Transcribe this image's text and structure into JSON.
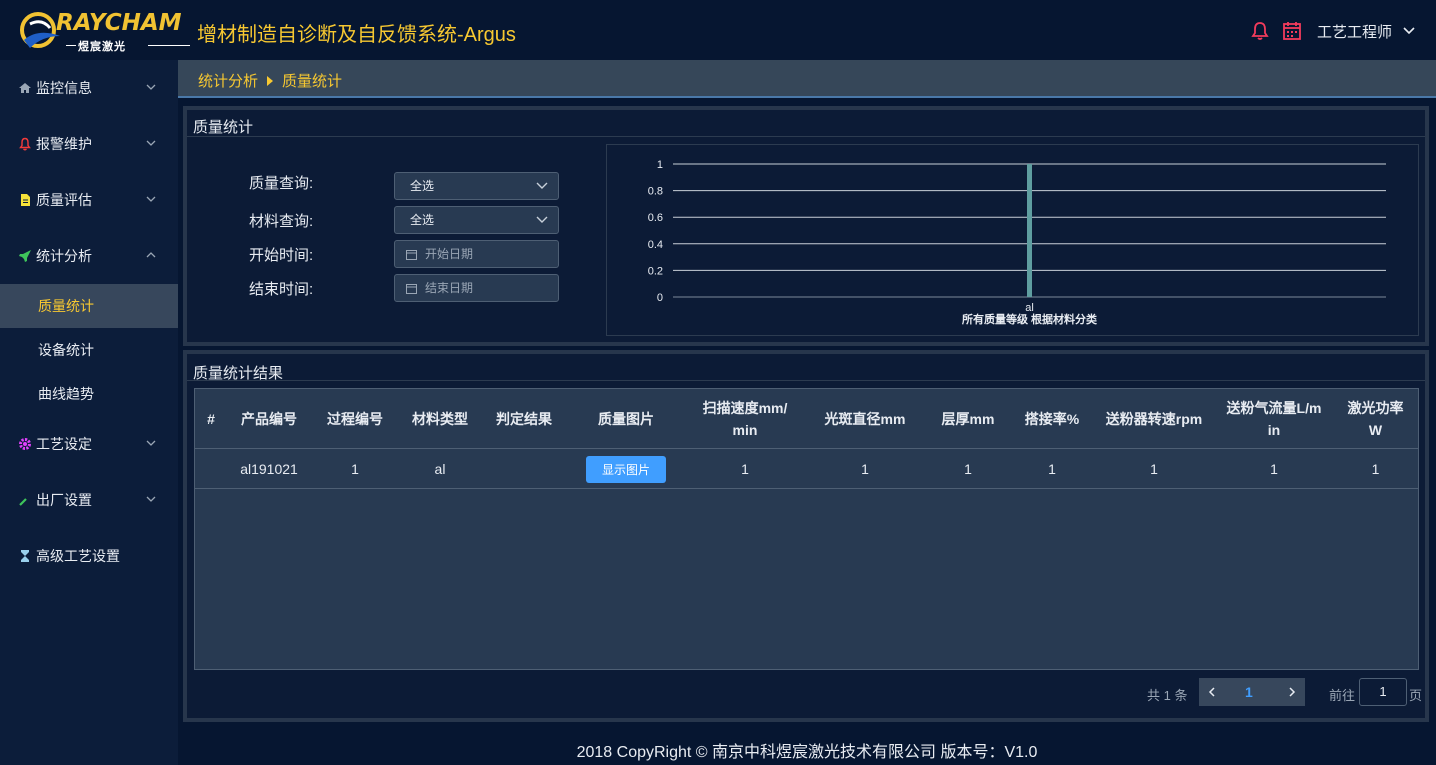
{
  "header": {
    "logo_text": "RAYCHAM",
    "logo_sub": "煜宸激光",
    "app_title": "增材制造自诊断及自反馈系统-Argus",
    "user_name": "工艺工程师"
  },
  "sidebar": {
    "items": [
      {
        "label": "监控信息",
        "icon": "home-icon",
        "expanded": false
      },
      {
        "label": "报警维护",
        "icon": "bell-icon",
        "expanded": false
      },
      {
        "label": "质量评估",
        "icon": "document-icon",
        "expanded": false
      },
      {
        "label": "统计分析",
        "icon": "rocket-icon",
        "expanded": true
      },
      {
        "label": "工艺设定",
        "icon": "cog-icon",
        "expanded": false
      },
      {
        "label": "出厂设置",
        "icon": "wrench-icon",
        "expanded": false
      },
      {
        "label": "高级工艺设置",
        "icon": "hourglass-icon",
        "expanded": false
      }
    ],
    "sub_items": [
      {
        "label": "质量统计",
        "active": true
      },
      {
        "label": "设备统计",
        "active": false
      },
      {
        "label": "曲线趋势",
        "active": false
      }
    ]
  },
  "breadcrumb": {
    "parent": "统计分析",
    "current": "质量统计"
  },
  "filter_panel": {
    "title": "质量统计",
    "quality_label": "质量查询:",
    "quality_value": "全选",
    "material_label": "材料查询:",
    "material_value": "全选",
    "start_label": "开始时间:",
    "start_placeholder": "开始日期",
    "end_label": "结束时间:",
    "end_placeholder": "结束日期"
  },
  "chart_data": {
    "type": "bar",
    "categories": [
      "al"
    ],
    "values": [
      1
    ],
    "title": "",
    "xlabel": "所有质量等级 根据材料分类",
    "ylabel": "",
    "ylim": [
      0,
      1
    ],
    "yticks": [
      "0",
      "0.2",
      "0.4",
      "0.6",
      "0.8",
      "1"
    ],
    "grid": true,
    "bar_color": "#5f9ea0"
  },
  "result_panel": {
    "title": "质量统计结果",
    "columns": [
      "#",
      "产品编号",
      "过程编号",
      "材料类型",
      "判定结果",
      "质量图片",
      "扫描速度mm/\nmin",
      "光斑直径mm",
      "层厚mm",
      "搭接率%",
      "送粉器转速rpm",
      "送粉气流量L/m\nin",
      "激光功率\nW"
    ],
    "rows": [
      {
        "index": "",
        "product_no": "al191021",
        "process_no": "1",
        "material": "al",
        "result": "",
        "image_button": "显示图片",
        "scan_speed": "1",
        "spot_diameter": "1",
        "layer_thickness": "1",
        "overlap": "1",
        "feeder_rpm": "1",
        "gas_flow": "1",
        "laser_power": "1"
      }
    ]
  },
  "pagination": {
    "total": "共 1 条",
    "current_page": "1",
    "goto_label": "前往",
    "goto_value": "1",
    "page_unit": "页"
  },
  "footer": {
    "text": "2018 CopyRight © 南京中科煜宸激光技术有限公司 版本号：V1.0"
  },
  "colors": {
    "accent": "#f7c831",
    "primary": "#409eff",
    "bg": "#061631",
    "panel": "#0c1b36"
  }
}
